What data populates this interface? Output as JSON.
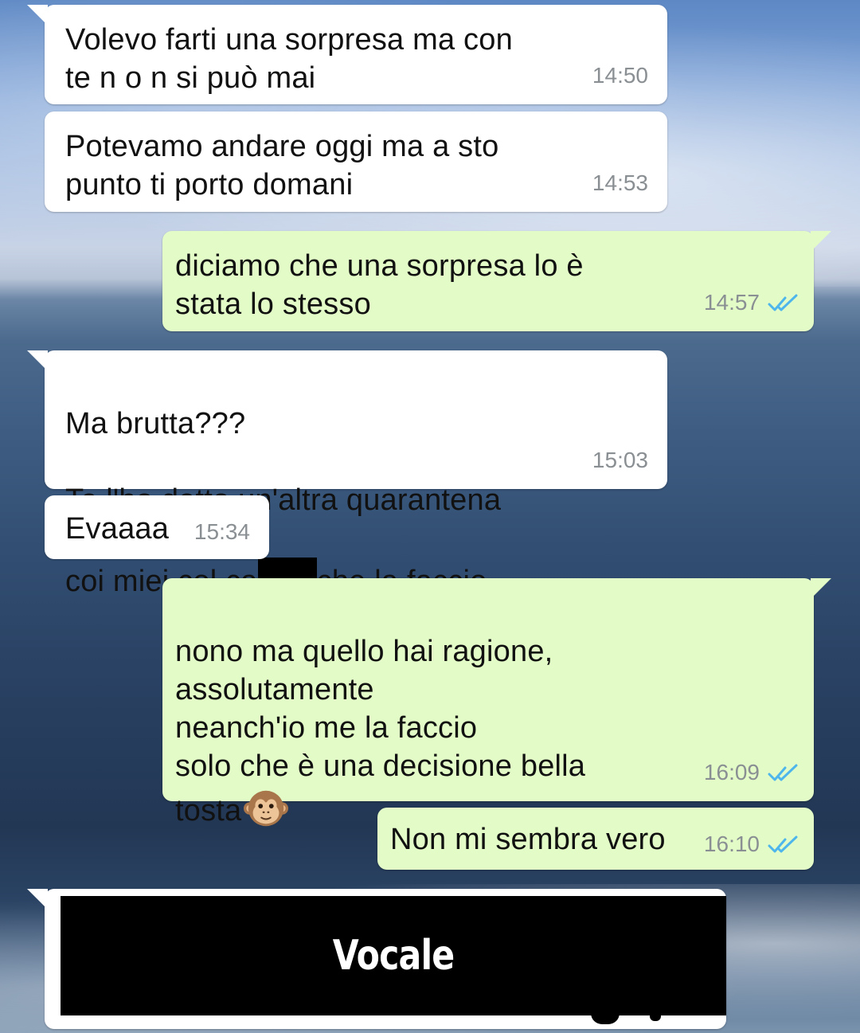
{
  "messages": [
    {
      "direction": "incoming",
      "text": "Volevo farti una sorpresa ma con\nte n o n si può mai",
      "time": "14:50"
    },
    {
      "direction": "incoming",
      "text": "Potevamo andare oggi ma a sto\npunto ti porto domani",
      "time": "14:53"
    },
    {
      "direction": "outgoing",
      "text": "diciamo che una sorpresa lo è\nstata lo stesso",
      "time": "14:57",
      "status": "read"
    },
    {
      "direction": "incoming",
      "text_lines": [
        "Ma brutta???",
        "Te l'ho detto un'altra quarantena"
      ],
      "text_before_redaction": "coi miei col ca",
      "text_after_redaction": "che la faccio",
      "time": "15:03"
    },
    {
      "direction": "incoming",
      "text": "Evaaaa",
      "time": "15:34"
    },
    {
      "direction": "outgoing",
      "text": "nono ma quello hai ragione,\nassolutamente\nneanch'io me la faccio\nsolo che è una decisione bella",
      "text_last_line": "tosta",
      "emoji": "monkey-face",
      "time": "16:09",
      "status": "read"
    },
    {
      "direction": "outgoing",
      "text": "Non mi sembra vero",
      "time": "16:10",
      "status": "read"
    },
    {
      "direction": "incoming",
      "type": "voice-redacted",
      "overlay_label": "Vocale"
    }
  ],
  "colors": {
    "incoming_bubble": "#ffffff",
    "outgoing_bubble": "#e3fcc7",
    "timestamp": "#8a8f93",
    "read_ticks": "#4fb6ec"
  },
  "icons": {
    "read_status": "double-check-icon",
    "emoji": "monkey-face-icon"
  }
}
